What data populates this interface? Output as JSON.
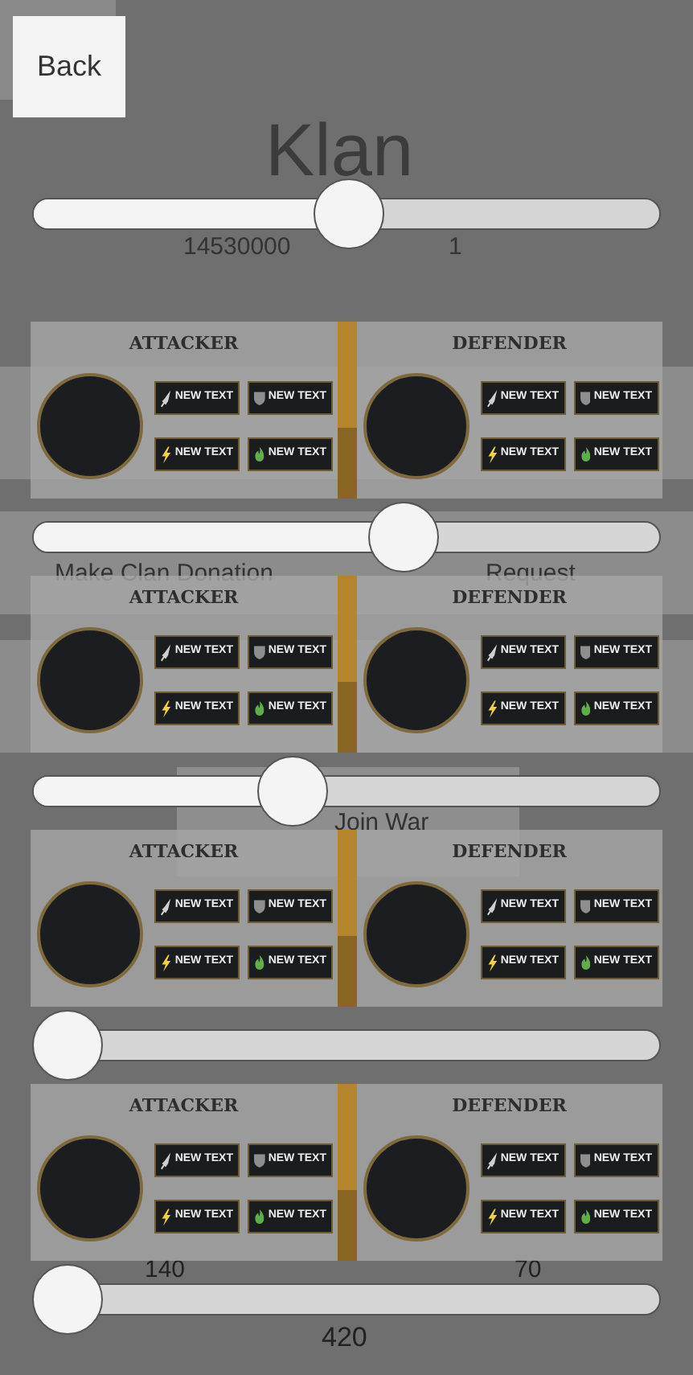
{
  "back_button": {
    "label": "Back"
  },
  "background_texts": [
    {
      "kind": "title",
      "text": "Klan"
    },
    {
      "kind": "left",
      "text": "14530000"
    },
    {
      "kind": "right",
      "text": "1"
    },
    {
      "kind": "donation",
      "text": "Make Clan Donation"
    },
    {
      "kind": "request",
      "text": "Request"
    },
    {
      "kind": "join",
      "text": "Join War"
    },
    {
      "kind": "stat_left",
      "text": "140"
    },
    {
      "kind": "stat_right",
      "text": "70"
    },
    {
      "kind": "total",
      "text": "420"
    }
  ],
  "sliders": [
    {
      "level": 0.5
    },
    {
      "level": 0.6
    },
    {
      "level": 0.4
    },
    {
      "level": 0
    },
    {
      "level": 0
    }
  ],
  "matchups": [
    {
      "sides": [
        {
          "heading": "ATTACKER",
          "stats": [
            {
              "kind": "sword",
              "text": "NEW TEXT"
            },
            {
              "kind": "shield",
              "text": "NEW TEXT"
            },
            {
              "kind": "bolt",
              "text": "NEW TEXT"
            },
            {
              "kind": "flame",
              "text": "NEW TEXT"
            }
          ]
        },
        {
          "heading": "DEFENDER",
          "stats": [
            {
              "kind": "sword",
              "text": "NEW TEXT"
            },
            {
              "kind": "shield",
              "text": "NEW TEXT"
            },
            {
              "kind": "bolt",
              "text": "NEW TEXT"
            },
            {
              "kind": "flame",
              "text": "NEW TEXT"
            }
          ]
        }
      ]
    },
    {
      "sides": [
        {
          "heading": "ATTACKER",
          "stats": [
            {
              "kind": "sword",
              "text": "NEW TEXT"
            },
            {
              "kind": "shield",
              "text": "NEW TEXT"
            },
            {
              "kind": "bolt",
              "text": "NEW TEXT"
            },
            {
              "kind": "flame",
              "text": "NEW TEXT"
            }
          ]
        },
        {
          "heading": "DEFENDER",
          "stats": [
            {
              "kind": "sword",
              "text": "NEW TEXT"
            },
            {
              "kind": "shield",
              "text": "NEW TEXT"
            },
            {
              "kind": "bolt",
              "text": "NEW TEXT"
            },
            {
              "kind": "flame",
              "text": "NEW TEXT"
            }
          ]
        }
      ]
    },
    {
      "sides": [
        {
          "heading": "ATTACKER",
          "stats": [
            {
              "kind": "sword",
              "text": "NEW TEXT"
            },
            {
              "kind": "shield",
              "text": "NEW TEXT"
            },
            {
              "kind": "bolt",
              "text": "NEW TEXT"
            },
            {
              "kind": "flame",
              "text": "NEW TEXT"
            }
          ]
        },
        {
          "heading": "DEFENDER",
          "stats": [
            {
              "kind": "sword",
              "text": "NEW TEXT"
            },
            {
              "kind": "shield",
              "text": "NEW TEXT"
            },
            {
              "kind": "bolt",
              "text": "NEW TEXT"
            },
            {
              "kind": "flame",
              "text": "NEW TEXT"
            }
          ]
        }
      ]
    },
    {
      "sides": [
        {
          "heading": "ATTACKER",
          "stats": [
            {
              "kind": "sword",
              "text": "NEW TEXT"
            },
            {
              "kind": "shield",
              "text": "NEW TEXT"
            },
            {
              "kind": "bolt",
              "text": "NEW TEXT"
            },
            {
              "kind": "flame",
              "text": "NEW TEXT"
            }
          ]
        },
        {
          "heading": "DEFENDER",
          "stats": [
            {
              "kind": "sword",
              "text": "NEW TEXT"
            },
            {
              "kind": "shield",
              "text": "NEW TEXT"
            },
            {
              "kind": "bolt",
              "text": "NEW TEXT"
            },
            {
              "kind": "flame",
              "text": "NEW TEXT"
            }
          ]
        }
      ]
    }
  ]
}
